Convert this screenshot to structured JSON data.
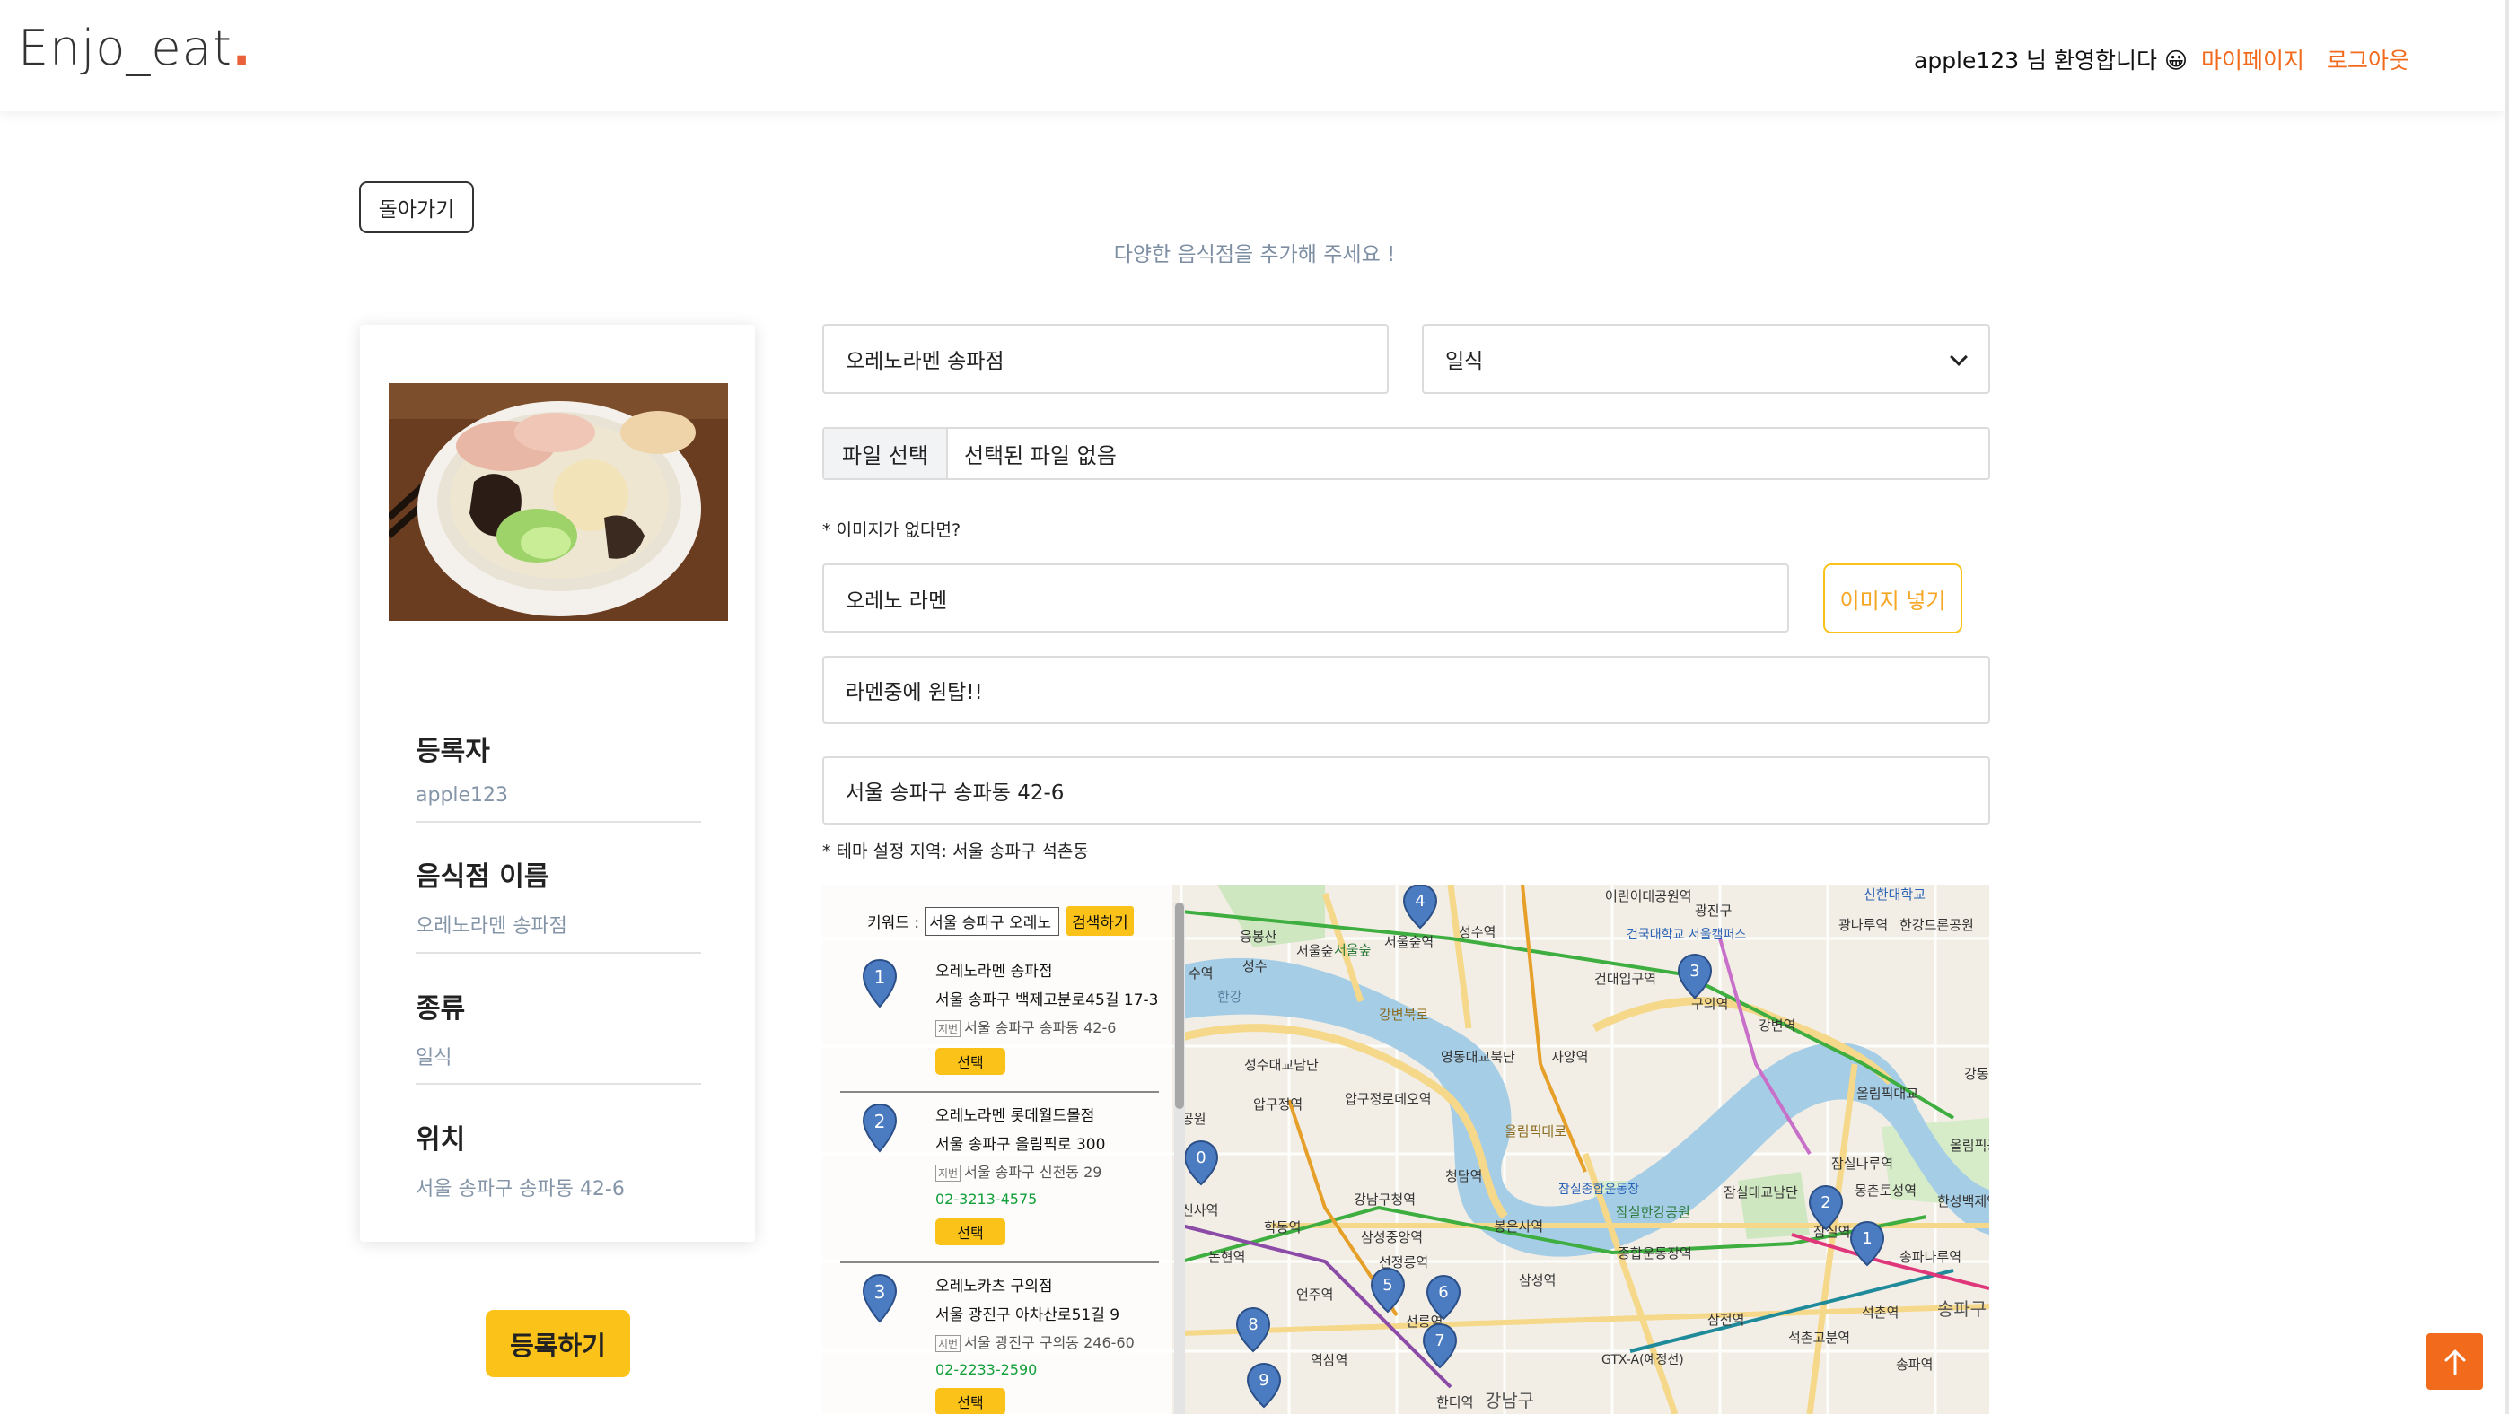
{
  "header": {
    "logo_text": "Enjo_eat",
    "logo_dot": ".",
    "welcome": "apple123 님 환영합니다 😀",
    "mypage_link": "마이페이지",
    "logout_link": "로그아웃"
  },
  "page": {
    "back_button": "돌아가기",
    "subtitle": "다양한 음식점을 추가해 주세요 !"
  },
  "summary": {
    "image_alt": "ramen-photo",
    "rows": [
      {
        "label": "등록자",
        "value": "apple123"
      },
      {
        "label": "음식점 이름",
        "value": "오레노라멘 송파점"
      },
      {
        "label": "종류",
        "value": "일식"
      },
      {
        "label": "위치",
        "value": "서울 송파구 송파동 42-6"
      }
    ],
    "register_button": "등록하기"
  },
  "form": {
    "name_value": "오레노라멘 송파점",
    "category_value": "일식",
    "file_button": "파일 선택",
    "file_name": "선택된 파일 없음",
    "no_image_note": "* 이미지가 없다면?",
    "image_keyword_value": "오레노 라멘",
    "image_button": "이미지 넣기",
    "description_value": "라멘중에 원탑!!",
    "address_value": "서울 송파구 송파동 42-6",
    "region_note": "* 테마 설정 지역: 서울 송파구 석촌동"
  },
  "map": {
    "keyword_label": "키워드 :",
    "keyword_value": "서울 송파구 오레노",
    "search_button": "검색하기",
    "results": [
      {
        "num": "1",
        "name": "오레노라멘 송파점",
        "road": "서울 송파구 백제고분로45길 17-3",
        "jibun_tag": "지번",
        "jibun": "서울 송파구 송파동 42-6",
        "tel": "",
        "select": "선택"
      },
      {
        "num": "2",
        "name": "오레노라멘 롯데월드몰점",
        "road": "서울 송파구 올림픽로 300",
        "jibun_tag": "지번",
        "jibun": "서울 송파구 신천동 29",
        "tel": "02-3213-4575",
        "select": "선택"
      },
      {
        "num": "3",
        "name": "오레노카츠 구의점",
        "road": "서울 광진구 아차산로51길 9",
        "jibun_tag": "지번",
        "jibun": "서울 광진구 구의동 246-60",
        "tel": "02-2233-2590",
        "select": "선택"
      }
    ],
    "labels": [
      {
        "text": "성수역"
      },
      {
        "text": "서울숲역"
      },
      {
        "text": "건대입구역"
      },
      {
        "text": "구의역"
      },
      {
        "text": "강변역"
      },
      {
        "text": "광나루역"
      },
      {
        "text": "어린이대공원역"
      },
      {
        "text": "광진구"
      },
      {
        "text": "건국대학교 서울캠퍼스"
      },
      {
        "text": "한강드론공원"
      },
      {
        "text": "신한대학교"
      },
      {
        "text": "영동대교북단"
      },
      {
        "text": "자양역"
      },
      {
        "text": "청담역"
      },
      {
        "text": "압구정로데오역"
      },
      {
        "text": "압구정역"
      },
      {
        "text": "강남구청역"
      },
      {
        "text": "학동역"
      },
      {
        "text": "논현역"
      },
      {
        "text": "신사역"
      },
      {
        "text": "삼성중앙역"
      },
      {
        "text": "선정릉역"
      },
      {
        "text": "선릉역"
      },
      {
        "text": "봉은사역"
      },
      {
        "text": "삼성역"
      },
      {
        "text": "종합운동장역"
      },
      {
        "text": "잠실종합운동장"
      },
      {
        "text": "잠실한강공원"
      },
      {
        "text": "잠실대교남단"
      },
      {
        "text": "잠실나루역"
      },
      {
        "text": "잠실역"
      },
      {
        "text": "송파나루역"
      },
      {
        "text": "석촌역"
      },
      {
        "text": "송파구"
      },
      {
        "text": "송파역"
      },
      {
        "text": "석촌고분역"
      },
      {
        "text": "삼전역"
      },
      {
        "text": "몽촌토성역"
      },
      {
        "text": "올림픽대교"
      },
      {
        "text": "올림픽공원"
      },
      {
        "text": "한성백제역"
      },
      {
        "text": "언주역"
      },
      {
        "text": "역삼역"
      },
      {
        "text": "한티역"
      },
      {
        "text": "강남구"
      },
      {
        "text": "수역"
      },
      {
        "text": "성수"
      },
      {
        "text": "응봉산"
      },
      {
        "text": "서울숲"
      },
      {
        "text": "강변북로"
      },
      {
        "text": "성수대교남단"
      },
      {
        "text": "공원"
      },
      {
        "text": "한강"
      },
      {
        "text": "GTX-A(예정선)"
      },
      {
        "text": "강동"
      },
      {
        "text": "올림픽대로"
      }
    ],
    "pins": [
      {
        "num": "4"
      },
      {
        "num": "3"
      },
      {
        "num": "2"
      },
      {
        "num": "1"
      },
      {
        "num": "5"
      },
      {
        "num": "6"
      },
      {
        "num": "7"
      },
      {
        "num": "8"
      },
      {
        "num": "9"
      },
      {
        "num": "0"
      }
    ]
  },
  "colors": {
    "accent_orange": "#f26b1d",
    "accent_yellow": "#fbc21a",
    "muted_blue": "#8595a8"
  }
}
